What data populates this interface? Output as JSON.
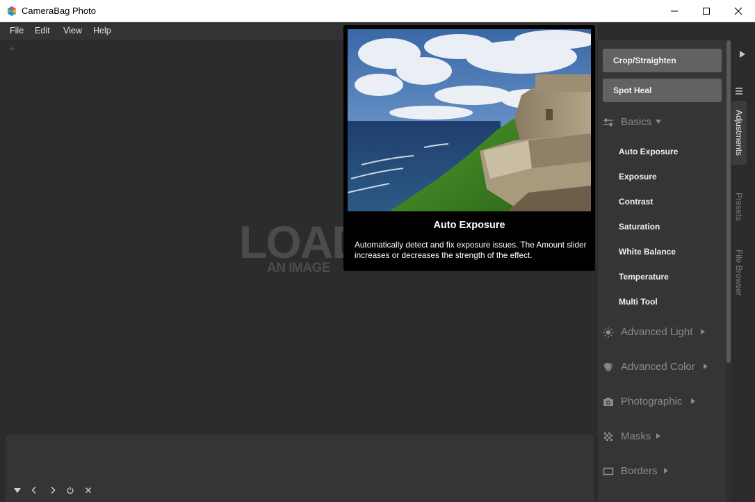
{
  "window": {
    "title": "CameraBag Photo"
  },
  "menu": [
    {
      "label": "File"
    },
    {
      "label": "Edit"
    },
    {
      "label": "View"
    },
    {
      "label": "Help"
    }
  ],
  "canvas": {
    "add_symbol": "+",
    "load_text": "LOAD",
    "image_text": "AN IMAGE"
  },
  "tooltip": {
    "title": "Auto Exposure",
    "description": "Automatically detect and fix exposure issues. The Amount slider increases or decreases the strength of the effect."
  },
  "tools": [
    {
      "label": "Crop/Straighten"
    },
    {
      "label": "Spot Heal"
    }
  ],
  "sections": {
    "basics": {
      "label": "Basics",
      "icon": "sliders-icon",
      "expanded": true
    },
    "advanced_light": {
      "label": "Advanced Light",
      "icon": "sun-icon"
    },
    "advanced_color": {
      "label": "Advanced Color",
      "icon": "color-circles-icon"
    },
    "photographic": {
      "label": "Photographic",
      "icon": "camera-icon"
    },
    "masks": {
      "label": "Masks",
      "icon": "checkerboard-icon"
    },
    "borders": {
      "label": "Borders",
      "icon": "border-frame-icon"
    }
  },
  "basics_items": [
    {
      "label": "Auto Exposure"
    },
    {
      "label": "Exposure"
    },
    {
      "label": "Contrast"
    },
    {
      "label": "Saturation"
    },
    {
      "label": "White Balance"
    },
    {
      "label": "Temperature"
    },
    {
      "label": "Multi Tool"
    }
  ],
  "side_tabs": [
    {
      "label": "Adjustments",
      "active": true
    },
    {
      "label": "Presets",
      "active": false
    },
    {
      "label": "File Browser",
      "active": false
    }
  ],
  "colors": {
    "panel_bg": "#353535",
    "canvas_bg": "#2c2c2c",
    "button_bg": "#626262",
    "tooltip_bg": "#000000",
    "section_text": "#8b8b8b"
  }
}
